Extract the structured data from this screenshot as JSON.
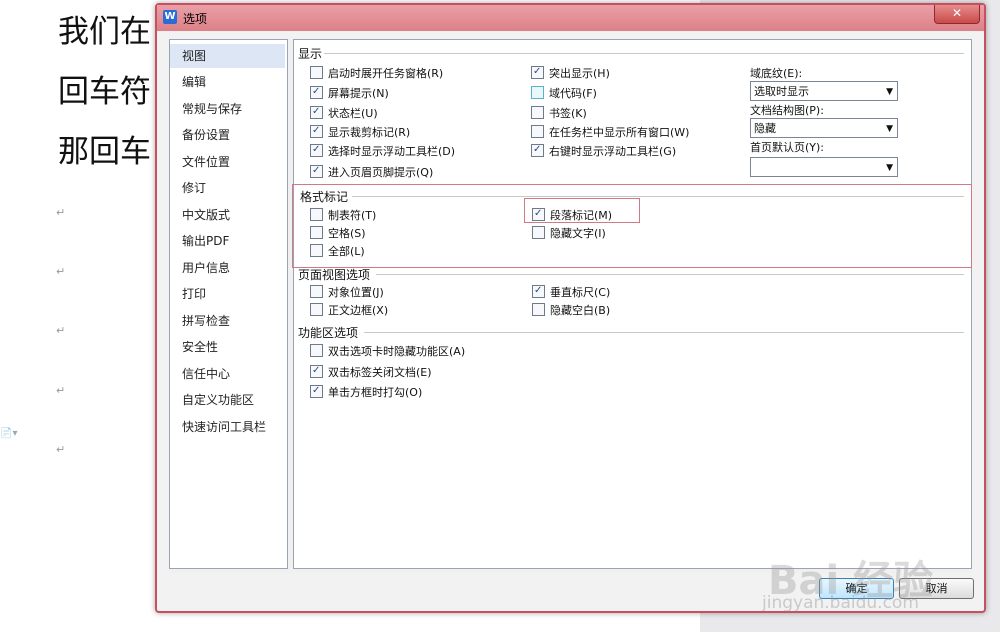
{
  "document": {
    "lines": [
      "我们在",
      "回车符",
      "那回车"
    ],
    "paragraph_mark": "↵"
  },
  "dialog": {
    "title": "选项",
    "app_icon_letter": "W",
    "close_symbol": "✕",
    "nav": [
      "视图",
      "编辑",
      "常规与保存",
      "备份设置",
      "文件位置",
      "修订",
      "中文版式",
      "输出PDF",
      "用户信息",
      "打印",
      "拼写检查",
      "安全性",
      "信任中心",
      "自定义功能区",
      "快速访问工具栏"
    ],
    "sections": {
      "display": {
        "title": "显示",
        "col1": [
          {
            "label": "启动时展开任务窗格(R)",
            "checked": false
          },
          {
            "label": "屏幕提示(N)",
            "checked": true
          },
          {
            "label": "状态栏(U)",
            "checked": true
          },
          {
            "label": "显示裁剪标记(R)",
            "checked": true
          },
          {
            "label": "选择时显示浮动工具栏(D)",
            "checked": true
          },
          {
            "label": "进入页眉页脚提示(Q)",
            "checked": true
          }
        ],
        "col2": [
          {
            "label": "突出显示(H)",
            "checked": true
          },
          {
            "label": "域代码(F)",
            "checked": false
          },
          {
            "label": "书签(K)",
            "checked": false
          },
          {
            "label": "在任务栏中显示所有窗口(W)",
            "checked": false
          },
          {
            "label": "右键时显示浮动工具栏(G)",
            "checked": true
          }
        ],
        "field_shading": {
          "label": "域底纹(E):",
          "value": "选取时显示"
        },
        "doc_map": {
          "label": "文档结构图(P):",
          "value": "隐藏"
        },
        "first_page": {
          "label": "首页默认页(Y):",
          "value": ""
        }
      },
      "format_marks": {
        "title": "格式标记",
        "col1": [
          {
            "label": "制表符(T)",
            "checked": false
          },
          {
            "label": "空格(S)",
            "checked": false
          },
          {
            "label": "全部(L)",
            "checked": false
          }
        ],
        "col2": [
          {
            "label": "段落标记(M)",
            "checked": true
          },
          {
            "label": "隐藏文字(I)",
            "checked": false
          }
        ]
      },
      "page_view": {
        "title": "页面视图选项",
        "col1": [
          {
            "label": "对象位置(J)",
            "checked": false
          },
          {
            "label": "正文边框(X)",
            "checked": false
          }
        ],
        "col2": [
          {
            "label": "垂直标尺(C)",
            "checked": true
          },
          {
            "label": "隐藏空白(B)",
            "checked": false
          }
        ]
      },
      "ribbon": {
        "title": "功能区选项",
        "items": [
          {
            "label": "双击选项卡时隐藏功能区(A)",
            "checked": false
          },
          {
            "label": "双击标签关闭文档(E)",
            "checked": true
          },
          {
            "label": "单击方框时打勾(O)",
            "checked": true
          }
        ]
      }
    },
    "ok_label": "确定",
    "cancel_label": "取消"
  },
  "watermark": {
    "main": "Bai 经验",
    "sub": "jingyan.baidu.com"
  },
  "colors": {
    "title_bar": "#dd8088",
    "accent_border": "#c75060",
    "highlight_box": "#d07a86"
  }
}
